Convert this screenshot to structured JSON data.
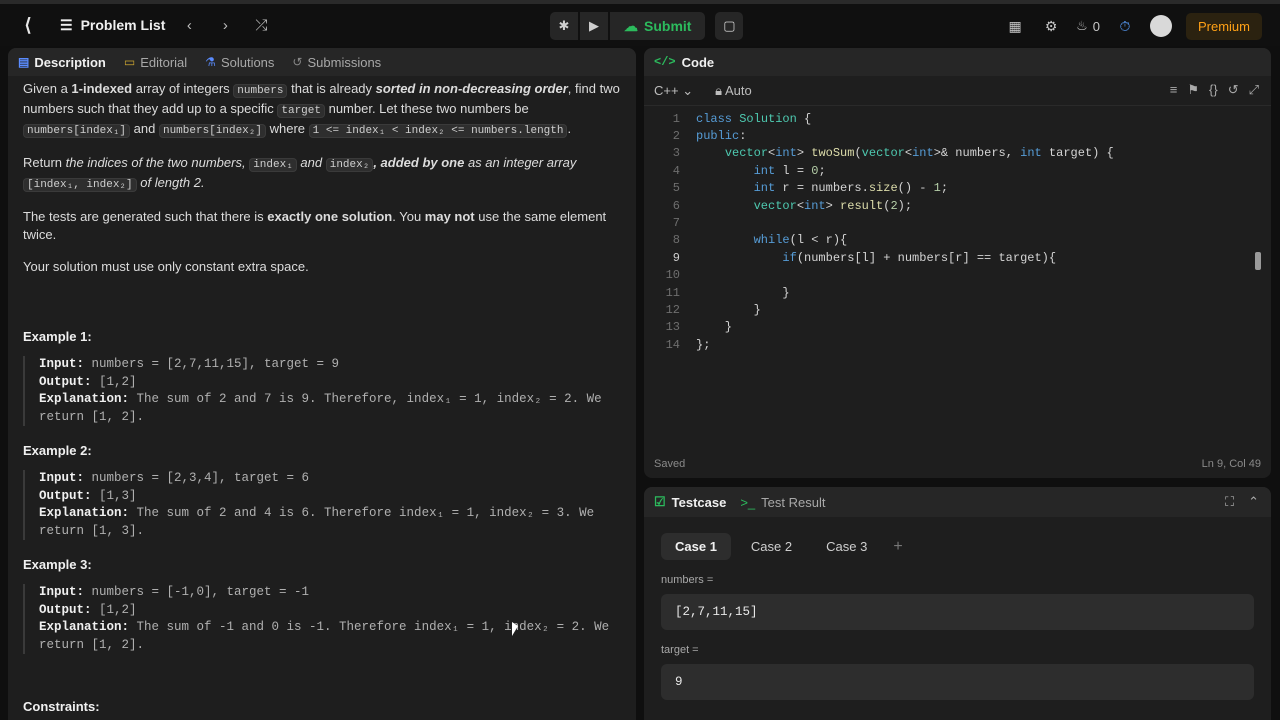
{
  "topbar": {
    "problem_list": "Problem List",
    "submit": "Submit",
    "streak_count": "0",
    "premium": "Premium"
  },
  "left_tabs": [
    {
      "label": "Description"
    },
    {
      "label": "Editorial"
    },
    {
      "label": "Solutions"
    },
    {
      "label": "Submissions"
    }
  ],
  "description": {
    "p1_a": "Given a ",
    "p1_b": "1-indexed",
    "p1_c": " array of integers ",
    "p1_code1": "numbers",
    "p1_d": " that is already ",
    "p1_e": "sorted in non-decreasing order",
    "p1_f": ", find two numbers such that they add up to a specific ",
    "p1_code2": "target",
    "p1_g": " number. Let these two numbers be ",
    "p1_code3": "numbers[index₁]",
    "p1_h": " and ",
    "p1_code4": "numbers[index₂]",
    "p1_i": " where ",
    "p1_code5": "1 <= index₁ < index₂ <= numbers.length",
    "p1_j": ".",
    "p2_a": "Return ",
    "p2_b": "the indices of the two numbers, ",
    "p2_code1": "index₁",
    "p2_c": " and ",
    "p2_code2": "index₂",
    "p2_d": ", added by one",
    "p2_e": " as an integer array ",
    "p2_code3": "[index₁, index₂]",
    "p2_f": " of length 2.",
    "p3_a": "The tests are generated such that there is ",
    "p3_b": "exactly one solution",
    "p3_c": ". You ",
    "p3_d": "may not",
    "p3_e": " use the same element twice.",
    "p4": "Your solution must use only constant extra space.",
    "examples": [
      {
        "title": "Example 1:",
        "input_label": "Input:",
        "input": " numbers = [2,7,11,15], target = 9",
        "output_label": "Output:",
        "output": " [1,2]",
        "expl_label": "Explanation:",
        "expl": " The sum of 2 and 7 is 9. Therefore, index₁ = 1, index₂ = 2. We return [1, 2]."
      },
      {
        "title": "Example 2:",
        "input_label": "Input:",
        "input": " numbers = [2,3,4], target = 6",
        "output_label": "Output:",
        "output": " [1,3]",
        "expl_label": "Explanation:",
        "expl": " The sum of 2 and 4 is 6. Therefore index₁ = 1, index₂ = 3. We return [1, 3]."
      },
      {
        "title": "Example 3:",
        "input_label": "Input:",
        "input": " numbers = [-1,0], target = -1",
        "output_label": "Output:",
        "output": " [1,2]",
        "expl_label": "Explanation:",
        "expl": " The sum of -1 and 0 is -1. Therefore index₁ = 1, index₂ = 2. We return [1, 2]."
      }
    ],
    "constraints": "Constraints:"
  },
  "code_panel": {
    "title": "Code",
    "language": "C++",
    "auto": "Auto",
    "saved": "Saved",
    "position": "Ln 9, Col 49",
    "current_line": 9,
    "lines": [
      "class Solution {",
      "public:",
      "    vector<int> twoSum(vector<int>& numbers, int target) {",
      "        int l = 0;",
      "        int r = numbers.size() - 1;",
      "        vector<int> result(2);",
      "",
      "        while(l < r){",
      "            if(numbers[l] + numbers[r] == target){",
      "",
      "            }",
      "        }",
      "    }",
      "};"
    ]
  },
  "test_panel": {
    "tab_testcase": "Testcase",
    "tab_result": "Test Result",
    "cases": [
      "Case 1",
      "Case 2",
      "Case 3"
    ],
    "add": "+",
    "fields": [
      {
        "label": "numbers =",
        "value": "[2,7,11,15]"
      },
      {
        "label": "target =",
        "value": "9"
      }
    ]
  }
}
